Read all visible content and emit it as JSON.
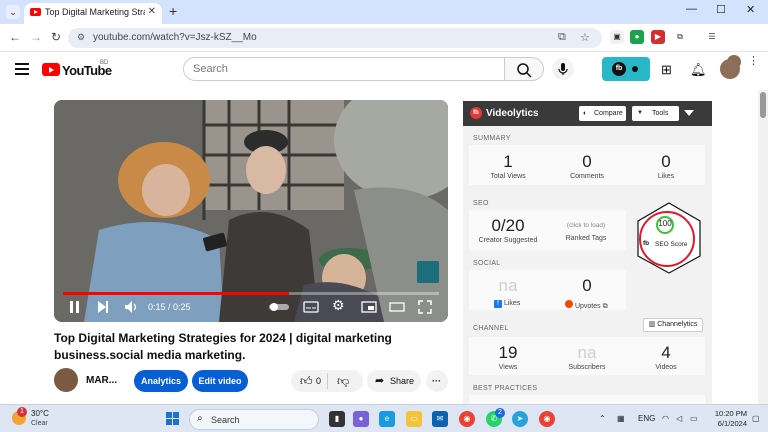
{
  "browser": {
    "tab_title": "Top Digital Marketing Strategie",
    "url": "youtube.com/watch?v=Jsz-kSZ__Mo"
  },
  "youtube": {
    "logo_text": "YouTube",
    "country_code": "BD",
    "search_placeholder": "Search"
  },
  "player": {
    "time": "0:15 / 0:25",
    "progress_fraction": 0.6,
    "buffered_fraction": 0.0
  },
  "video": {
    "title": "Top Digital Marketing Strategies for 2024 | digital marketing business.social media marketing.",
    "owner": "MAR...",
    "analytics_label": "Analytics",
    "edit_label": "Edit video",
    "likes": "0",
    "share_label": "Share"
  },
  "videolytics": {
    "title": "Videolytics",
    "compare_label": "Compare",
    "tools_label": "Tools",
    "summary": {
      "heading": "SUMMARY",
      "items": [
        {
          "value": "1",
          "label": "Total Views"
        },
        {
          "value": "0",
          "label": "Comments"
        },
        {
          "value": "0",
          "label": "Likes"
        }
      ]
    },
    "seo": {
      "heading": "SEO",
      "creator_value": "0/20",
      "creator_label": "Creator Suggested",
      "ranked_hint": "(click to load)",
      "ranked_label": "Ranked Tags",
      "score": "100",
      "score_label": "SEO Score"
    },
    "social": {
      "heading": "SOCIAL",
      "likes_value": "na",
      "likes_label": "Likes",
      "upvotes_value": "0",
      "upvotes_label": "Upvotes"
    },
    "channel": {
      "heading": "CHANNEL",
      "channelytics_label": "Channelytics",
      "items": [
        {
          "value": "19",
          "label": "Views"
        },
        {
          "value": "na",
          "label": "Subscribers"
        },
        {
          "value": "4",
          "label": "Videos"
        }
      ]
    },
    "best_practices": {
      "heading": "BEST PRACTICES"
    }
  },
  "taskbar": {
    "weather_temp": "30°C",
    "weather_desc": "Clear",
    "weather_badge": "1",
    "search_placeholder": "Search",
    "lang": "ENG",
    "time": "10:20 PM",
    "date": "6/1/2024",
    "whatsapp_badge": "2"
  }
}
